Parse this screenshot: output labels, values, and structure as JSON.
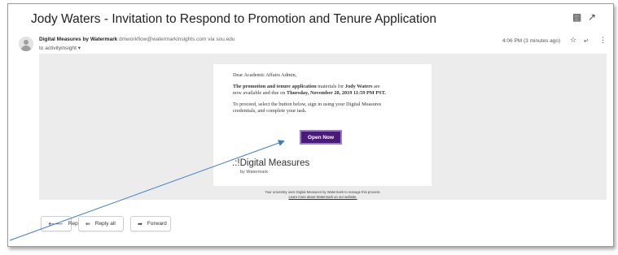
{
  "subject": "Jody Waters - Invitation to Respond to Promotion and Tenure Application",
  "icons": {
    "print": "print-icon",
    "external": "open-in-new-window-icon",
    "star": "star-icon",
    "reply": "reply-icon",
    "more": "more-options-icon",
    "avatar": "avatar-icon",
    "caret": "caret-down-icon"
  },
  "sender": {
    "name": "Digital Measures by Watermark",
    "email": "dmworkflow@watermarkinsights.com",
    "via": "via",
    "via_domain": "sou.edu",
    "to": "to activityinsight"
  },
  "timestamp": "4:06 PM (3 minutes ago)",
  "email_body": {
    "greeting": "Dear Academic Affairs Admin,",
    "line1_bold": "The promotion and tenure application",
    "line1_rest": " materials for ",
    "line1_name": "Jody Waters",
    "line1_end": " are",
    "line2_start": "now available and due on ",
    "line2_date": "Thursday, November 28, 2019 11:59 PM PST.",
    "line3": "To proceed, select the button below, sign in using your Digital Measures",
    "line4": "credentials, and complete your task.",
    "button_label": "Open Now",
    "logo_text": ".:!Digital Measures",
    "logo_sub": "by Watermark·",
    "footer_line1": "Your university uses Digital Measures by Watermark to manage this process.",
    "footer_line2": "Learn more about Watermark on our website."
  },
  "actions": {
    "reply": "Reply",
    "reply_all": "Reply all",
    "forward": "Forward"
  },
  "colors": {
    "button_bg": "#4a1a7a",
    "arrow": "#3a7cc9",
    "body_bg": "#ececec"
  }
}
